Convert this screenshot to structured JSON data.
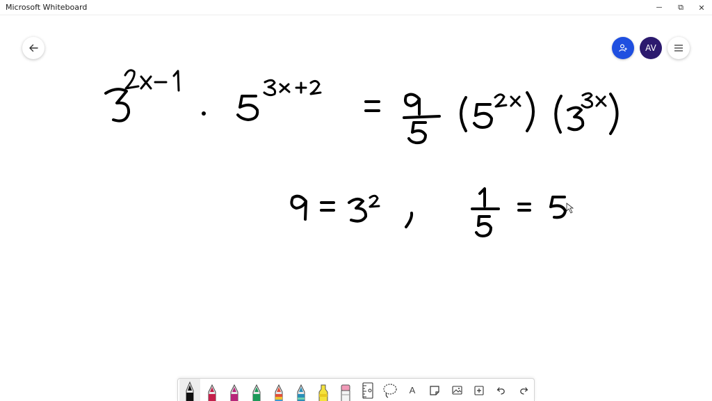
{
  "window": {
    "title": "Microsoft Whiteboard",
    "minimize": "─",
    "restore": "⧉",
    "close": "✕"
  },
  "header": {
    "back_icon": "arrow-left-icon",
    "invite_icon": "person-add-icon",
    "avatar_initials": "AV",
    "menu_icon": "hamburger-menu-icon"
  },
  "toolbar": {
    "tools": [
      {
        "name": "black-pen",
        "color": "#111111",
        "selected": true
      },
      {
        "name": "red-pen",
        "color": "#c4204a"
      },
      {
        "name": "magenta-pen",
        "color": "#b7277a"
      },
      {
        "name": "green-pen",
        "color": "#1d9a5a"
      },
      {
        "name": "rainbow-pen",
        "color": "#e0503a"
      },
      {
        "name": "galaxy-pen",
        "color": "#2a8fb8"
      },
      {
        "name": "highlighter",
        "color": "#f4e23c"
      },
      {
        "name": "eraser",
        "color": "#f19ab8"
      },
      {
        "name": "ruler-icon"
      },
      {
        "name": "lasso-icon"
      },
      {
        "name": "text-icon"
      },
      {
        "name": "sticky-note-icon"
      },
      {
        "name": "image-icon"
      },
      {
        "name": "add-icon"
      },
      {
        "name": "undo-icon"
      },
      {
        "name": "redo-icon"
      }
    ],
    "text_tool_label": "A"
  },
  "handwriting": {
    "line1_lhs": "3^(2x-1) · 5^(3x+2)",
    "line1_rhs": "= 9/5 (5^(2x)) (3^(3x))",
    "line2": "9 = 3^2 ,  1/5 = 5"
  }
}
